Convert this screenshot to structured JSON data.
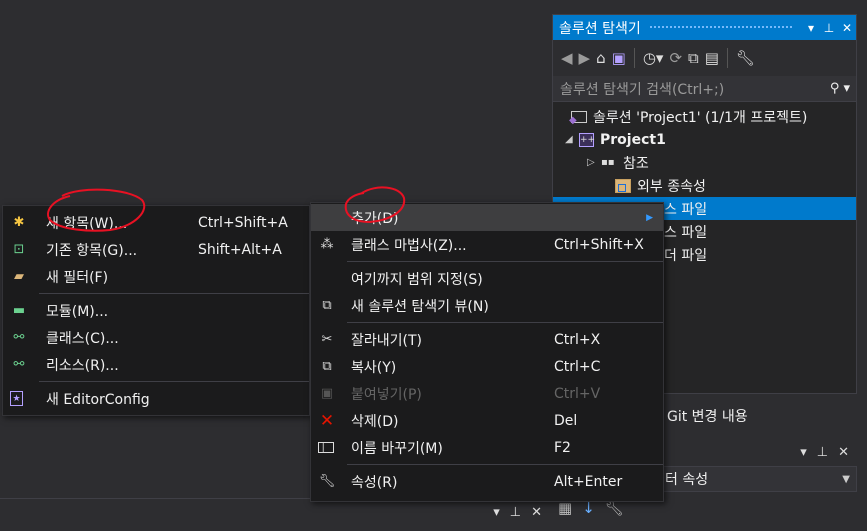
{
  "solution_explorer": {
    "title": "솔루션 탐색기",
    "title_buttons": [
      "▾",
      "📌",
      "✕"
    ],
    "search_placeholder": "솔루션 탐색기 검색(Ctrl+;)",
    "tree": [
      {
        "label": "솔루션 'Project1' (1/1개 프로젝트)",
        "icon": "solution-icon",
        "bold": false
      },
      {
        "label": "Project1",
        "icon": "cpp-project-icon",
        "bold": true,
        "expander": "◢"
      },
      {
        "label": "참조",
        "icon": "references-icon",
        "expander": "▷"
      },
      {
        "label": "외부 종속성",
        "icon": "external-deps-icon"
      },
      {
        "label": "스 파일",
        "icon": "folder-icon"
      },
      {
        "label": "스 파일",
        "icon": "folder-icon"
      },
      {
        "label": "더 파일",
        "icon": "folder-icon"
      }
    ]
  },
  "git_tab": "Git 변경 내용",
  "properties": {
    "combo_text": "터 속성",
    "title_buttons": [
      "▾",
      "📌",
      "✕"
    ]
  },
  "bottom_strip_buttons": [
    "▾",
    "📌",
    "✕"
  ],
  "left_menu": {
    "items": [
      {
        "label": "새 항목(W)...",
        "shortcut": "Ctrl+Shift+A",
        "icon": "new-item-icon"
      },
      {
        "label": "기존 항목(G)...",
        "shortcut": "Shift+Alt+A",
        "icon": "existing-item-icon"
      },
      {
        "label": "새 필터(F)",
        "shortcut": "",
        "icon": "new-filter-icon"
      },
      {
        "label": "모듈(M)...",
        "shortcut": "",
        "icon": "module-icon"
      },
      {
        "label": "클래스(C)...",
        "shortcut": "",
        "icon": "class-icon"
      },
      {
        "label": "리소스(R)...",
        "shortcut": "",
        "icon": "resource-icon"
      },
      {
        "label": "새 EditorConfig",
        "shortcut": "",
        "icon": "editorconfig-icon"
      }
    ]
  },
  "right_menu": {
    "items": [
      {
        "label": "추가(D)",
        "shortcut": "",
        "icon": "",
        "submenu": true,
        "highlight": true
      },
      {
        "label": "클래스 마법사(Z)...",
        "shortcut": "Ctrl+Shift+X",
        "icon": "class-wizard-icon"
      },
      {
        "label": "여기까지 범위 지정(S)",
        "shortcut": "",
        "icon": ""
      },
      {
        "label": "새 솔루션 탐색기 뷰(N)",
        "shortcut": "",
        "icon": "new-view-icon"
      },
      {
        "label": "잘라내기(T)",
        "shortcut": "Ctrl+X",
        "icon": "cut-icon"
      },
      {
        "label": "복사(Y)",
        "shortcut": "Ctrl+C",
        "icon": "copy-icon"
      },
      {
        "label": "붙여넣기(P)",
        "shortcut": "Ctrl+V",
        "icon": "paste-icon",
        "disabled": true
      },
      {
        "label": "삭제(D)",
        "shortcut": "Del",
        "icon": "delete-icon"
      },
      {
        "label": "이름 바꾸기(M)",
        "shortcut": "F2",
        "icon": "rename-icon"
      },
      {
        "label": "속성(R)",
        "shortcut": "Alt+Enter",
        "icon": "properties-icon"
      }
    ]
  },
  "colors": {
    "background": "#2d2d30",
    "accent": "#007acc",
    "menu_bg": "#1b1b1c",
    "annotation": "#e81123"
  }
}
